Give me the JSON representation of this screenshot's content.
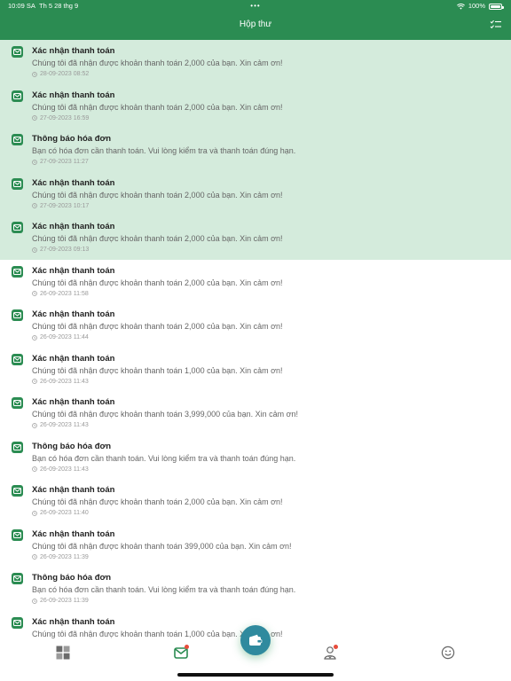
{
  "status_bar": {
    "time": "10:09 SA",
    "date": "Th 5 28 thg 9",
    "battery": "100%"
  },
  "header": {
    "title": "Hộp thư"
  },
  "notifications": [
    {
      "title": "Xác nhận thanh toán",
      "message": "Chúng tôi đã nhận được khoản thanh toán 2,000 của bạn. Xin cảm ơn!",
      "time": "28-09-2023 08:52",
      "unread": true
    },
    {
      "title": "Xác nhận thanh toán",
      "message": "Chúng tôi đã nhận được khoản thanh toán 2,000 của bạn. Xin cảm ơn!",
      "time": "27-09-2023 16:59",
      "unread": true
    },
    {
      "title": "Thông báo hóa đơn",
      "message": "Bạn có hóa đơn cần thanh toán. Vui lòng kiểm tra và thanh toán đúng hạn.",
      "time": "27-09-2023 11:27",
      "unread": true
    },
    {
      "title": "Xác nhận thanh toán",
      "message": "Chúng tôi đã nhận được khoản thanh toán 2,000 của bạn. Xin cảm ơn!",
      "time": "27-09-2023 10:17",
      "unread": true
    },
    {
      "title": "Xác nhận thanh toán",
      "message": "Chúng tôi đã nhận được khoản thanh toán 2,000 của bạn. Xin cảm ơn!",
      "time": "27-09-2023 09:13",
      "unread": true
    },
    {
      "title": "Xác nhận thanh toán",
      "message": "Chúng tôi đã nhận được khoản thanh toán 2,000 của bạn. Xin cảm ơn!",
      "time": "26-09-2023 11:58",
      "unread": false
    },
    {
      "title": "Xác nhận thanh toán",
      "message": "Chúng tôi đã nhận được khoản thanh toán 2,000 của bạn. Xin cảm ơn!",
      "time": "26-09-2023 11:44",
      "unread": false
    },
    {
      "title": "Xác nhận thanh toán",
      "message": "Chúng tôi đã nhận được khoản thanh toán 1,000 của bạn. Xin cảm ơn!",
      "time": "26-09-2023 11:43",
      "unread": false
    },
    {
      "title": "Xác nhận thanh toán",
      "message": "Chúng tôi đã nhận được khoản thanh toán 3,999,000 của bạn. Xin cảm ơn!",
      "time": "26-09-2023 11:43",
      "unread": false
    },
    {
      "title": "Thông báo hóa đơn",
      "message": "Bạn có hóa đơn cần thanh toán. Vui lòng kiểm tra và thanh toán đúng hạn.",
      "time": "26-09-2023 11:43",
      "unread": false
    },
    {
      "title": "Xác nhận thanh toán",
      "message": "Chúng tôi đã nhận được khoản thanh toán 2,000 của bạn. Xin cảm ơn!",
      "time": "26-09-2023 11:40",
      "unread": false
    },
    {
      "title": "Xác nhận thanh toán",
      "message": "Chúng tôi đã nhận được khoản thanh toán 399,000 của bạn. Xin cảm ơn!",
      "time": "26-09-2023 11:39",
      "unread": false
    },
    {
      "title": "Thông báo hóa đơn",
      "message": "Bạn có hóa đơn cần thanh toán. Vui lòng kiểm tra và thanh toán đúng hạn.",
      "time": "26-09-2023 11:39",
      "unread": false
    },
    {
      "title": "Xác nhận thanh toán",
      "message": "Chúng tôi đã nhận được khoản thanh toán 1,000 của bạn. Xin cảm ơn!",
      "time": "",
      "unread": false
    }
  ],
  "tabbar": {
    "icons": [
      "dashboard-icon",
      "inbox-icon",
      "wallet-icon",
      "person-icon",
      "smile-icon"
    ]
  },
  "colors": {
    "primary": "#2b8c52",
    "unread_bg": "#d4ebdc",
    "fab": "#2f8a9e",
    "badge": "#e74c3c"
  }
}
